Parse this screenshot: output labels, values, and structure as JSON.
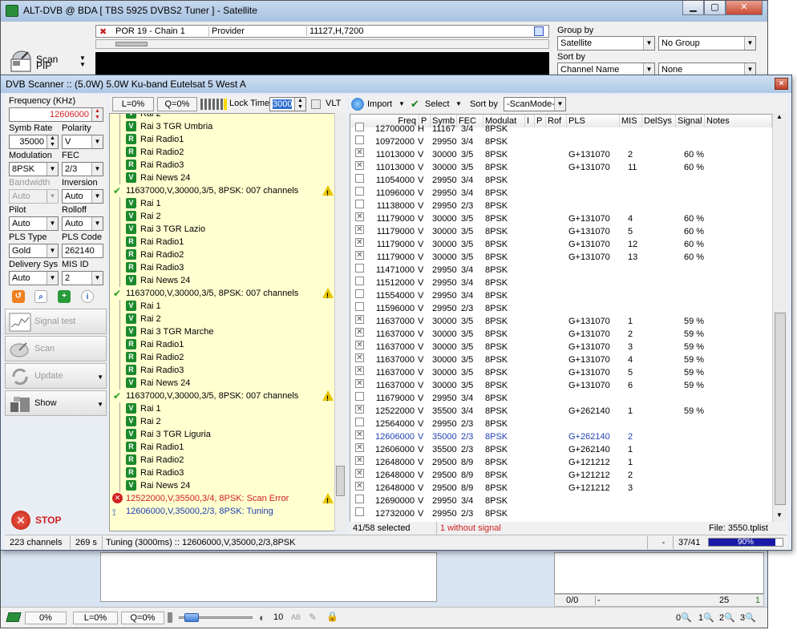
{
  "main_window": {
    "title": "ALT-DVB @ BDA [ TBS 5925 DVBS2 Tuner ] - Satellite",
    "toolbar": {
      "scan_label": "Scan",
      "pip_label": "PIP"
    },
    "status_strip": {
      "channel": "POR 19 - Chain 1",
      "provider": "Provider",
      "tp": "11127,H,7200"
    },
    "group_by": {
      "label": "Group by",
      "value": "Satellite",
      "secondary": "No Group"
    },
    "sort_by": {
      "label": "Sort by",
      "value": "Channel Name",
      "secondary": "None"
    },
    "lower": {
      "count": "0/0",
      "dash": "-",
      "num": "25",
      "num2": "1"
    },
    "bottom_bar": {
      "signal_percent": "0%",
      "level": "L=0%",
      "quality": "Q=0%",
      "volume": "10",
      "ab_label": "AB",
      "q_slots": [
        "0",
        "1",
        "2",
        "3"
      ]
    }
  },
  "scanner": {
    "title": "DVB Scanner :: (5.0W) 5.0W Ku-band Eutelsat 5 West A",
    "close_label": "×",
    "params": {
      "frequency_label": "Frequency (KHz)",
      "frequency_value": "12606000",
      "symb_rate_label": "Symb Rate",
      "symb_rate_value": "35000",
      "polarity_label": "Polarity",
      "polarity_value": "V",
      "modulation_label": "Modulation",
      "modulation_value": "8PSK",
      "fec_label": "FEC",
      "fec_value": "2/3",
      "bandwidth_label": "Bandwidth",
      "bandwidth_value": "Auto",
      "inversion_label": "Inversion",
      "inversion_value": "Auto",
      "pilot_label": "Pilot",
      "pilot_value": "Auto",
      "rolloff_label": "Rolloff",
      "rolloff_value": "Auto",
      "pls_type_label": "PLS Type",
      "pls_type_value": "Gold",
      "pls_code_label": "PLS Code",
      "pls_code_value": "262140",
      "delivery_sys_label": "Delivery Sys",
      "delivery_sys_value": "Auto",
      "mis_id_label": "MIS ID",
      "mis_id_value": "2"
    },
    "buttons": {
      "signal_test": "Signal test",
      "scan": "Scan",
      "update": "Update",
      "show": "Show",
      "stop": "STOP"
    },
    "tree_toolbar": {
      "level": "L=0%",
      "quality": "Q=0%",
      "lock_time_label": "Lock Time",
      "lock_time_value": "3000",
      "vlt_label": "VLT"
    },
    "tree": [
      {
        "type": "ch",
        "icon": "V",
        "text": "Rai 2"
      },
      {
        "type": "ch",
        "icon": "V",
        "text": "Rai 3 TGR Umbria"
      },
      {
        "type": "ch",
        "icon": "R",
        "text": "Rai Radio1"
      },
      {
        "type": "ch",
        "icon": "R",
        "text": "Rai Radio2"
      },
      {
        "type": "ch",
        "icon": "R",
        "text": "Rai Radio3"
      },
      {
        "type": "ch",
        "icon": "V",
        "text": "Rai News 24"
      },
      {
        "type": "tp",
        "text": "11637000,V,30000,3/5, 8PSK: 007 channels",
        "warn": true
      },
      {
        "type": "ch",
        "icon": "V",
        "text": "Rai 1"
      },
      {
        "type": "ch",
        "icon": "V",
        "text": "Rai 2"
      },
      {
        "type": "ch",
        "icon": "V",
        "text": "Rai 3 TGR Lazio"
      },
      {
        "type": "ch",
        "icon": "R",
        "text": "Rai Radio1"
      },
      {
        "type": "ch",
        "icon": "R",
        "text": "Rai Radio2"
      },
      {
        "type": "ch",
        "icon": "R",
        "text": "Rai Radio3"
      },
      {
        "type": "ch",
        "icon": "V",
        "text": "Rai News 24"
      },
      {
        "type": "tp",
        "text": "11637000,V,30000,3/5, 8PSK: 007 channels",
        "warn": true
      },
      {
        "type": "ch",
        "icon": "V",
        "text": "Rai 1"
      },
      {
        "type": "ch",
        "icon": "V",
        "text": "Rai 2"
      },
      {
        "type": "ch",
        "icon": "V",
        "text": "Rai 3 TGR Marche"
      },
      {
        "type": "ch",
        "icon": "R",
        "text": "Rai Radio1"
      },
      {
        "type": "ch",
        "icon": "R",
        "text": "Rai Radio2"
      },
      {
        "type": "ch",
        "icon": "R",
        "text": "Rai Radio3"
      },
      {
        "type": "ch",
        "icon": "V",
        "text": "Rai News 24"
      },
      {
        "type": "tp",
        "text": "11637000,V,30000,3/5, 8PSK: 007 channels",
        "warn": true
      },
      {
        "type": "ch",
        "icon": "V",
        "text": "Rai 1"
      },
      {
        "type": "ch",
        "icon": "V",
        "text": "Rai 2"
      },
      {
        "type": "ch",
        "icon": "V",
        "text": "Rai 3 TGR Liguria"
      },
      {
        "type": "ch",
        "icon": "R",
        "text": "Rai Radio1"
      },
      {
        "type": "ch",
        "icon": "R",
        "text": "Rai Radio2"
      },
      {
        "type": "ch",
        "icon": "R",
        "text": "Rai Radio3"
      },
      {
        "type": "ch",
        "icon": "V",
        "text": "Rai News 24"
      },
      {
        "type": "err",
        "text": "12522000,V,35500,3/4, 8PSK: Scan Error",
        "warn": true
      },
      {
        "type": "tune",
        "text": "12606000,V,35000,2/3, 8PSK: Tuning"
      }
    ],
    "grid_toolbar": {
      "import_label": "Import",
      "select_label": "Select",
      "sort_by_label": "Sort by",
      "sort_by_value": "-ScanMode-"
    },
    "grid_columns": [
      "Freq",
      "P",
      "Symb",
      "FEC",
      "Modulat",
      "I",
      "P",
      "Rof",
      "PLS",
      "MIS",
      "DelSys",
      "Signal",
      "Notes"
    ],
    "grid_rows": [
      {
        "checked": false,
        "freq": "12700000",
        "pol": "H",
        "symb": "11167",
        "fec": "3/4",
        "mod": "8PSK",
        "pls": "",
        "mis": "",
        "signal": ""
      },
      {
        "checked": false,
        "freq": "10972000",
        "pol": "V",
        "symb": "29950",
        "fec": "3/4",
        "mod": "8PSK",
        "pls": "",
        "mis": "",
        "signal": ""
      },
      {
        "checked": true,
        "freq": "11013000",
        "pol": "V",
        "symb": "30000",
        "fec": "3/5",
        "mod": "8PSK",
        "pls": "G+131070",
        "mis": "2",
        "signal": "60 %"
      },
      {
        "checked": true,
        "freq": "11013000",
        "pol": "V",
        "symb": "30000",
        "fec": "3/5",
        "mod": "8PSK",
        "pls": "G+131070",
        "mis": "11",
        "signal": "60 %"
      },
      {
        "checked": false,
        "freq": "11054000",
        "pol": "V",
        "symb": "29950",
        "fec": "3/4",
        "mod": "8PSK",
        "pls": "",
        "mis": "",
        "signal": ""
      },
      {
        "checked": false,
        "freq": "11096000",
        "pol": "V",
        "symb": "29950",
        "fec": "3/4",
        "mod": "8PSK",
        "pls": "",
        "mis": "",
        "signal": ""
      },
      {
        "checked": false,
        "freq": "11138000",
        "pol": "V",
        "symb": "29950",
        "fec": "2/3",
        "mod": "8PSK",
        "pls": "",
        "mis": "",
        "signal": ""
      },
      {
        "checked": true,
        "freq": "11179000",
        "pol": "V",
        "symb": "30000",
        "fec": "3/5",
        "mod": "8PSK",
        "pls": "G+131070",
        "mis": "4",
        "signal": "60 %"
      },
      {
        "checked": true,
        "freq": "11179000",
        "pol": "V",
        "symb": "30000",
        "fec": "3/5",
        "mod": "8PSK",
        "pls": "G+131070",
        "mis": "5",
        "signal": "60 %"
      },
      {
        "checked": true,
        "freq": "11179000",
        "pol": "V",
        "symb": "30000",
        "fec": "3/5",
        "mod": "8PSK",
        "pls": "G+131070",
        "mis": "12",
        "signal": "60 %"
      },
      {
        "checked": true,
        "freq": "11179000",
        "pol": "V",
        "symb": "30000",
        "fec": "3/5",
        "mod": "8PSK",
        "pls": "G+131070",
        "mis": "13",
        "signal": "60 %"
      },
      {
        "checked": false,
        "freq": "11471000",
        "pol": "V",
        "symb": "29950",
        "fec": "3/4",
        "mod": "8PSK",
        "pls": "",
        "mis": "",
        "signal": ""
      },
      {
        "checked": false,
        "freq": "11512000",
        "pol": "V",
        "symb": "29950",
        "fec": "3/4",
        "mod": "8PSK",
        "pls": "",
        "mis": "",
        "signal": ""
      },
      {
        "checked": false,
        "freq": "11554000",
        "pol": "V",
        "symb": "29950",
        "fec": "3/4",
        "mod": "8PSK",
        "pls": "",
        "mis": "",
        "signal": ""
      },
      {
        "checked": false,
        "freq": "11596000",
        "pol": "V",
        "symb": "29950",
        "fec": "2/3",
        "mod": "8PSK",
        "pls": "",
        "mis": "",
        "signal": ""
      },
      {
        "checked": true,
        "freq": "11637000",
        "pol": "V",
        "symb": "30000",
        "fec": "3/5",
        "mod": "8PSK",
        "pls": "G+131070",
        "mis": "1",
        "signal": "59 %"
      },
      {
        "checked": true,
        "freq": "11637000",
        "pol": "V",
        "symb": "30000",
        "fec": "3/5",
        "mod": "8PSK",
        "pls": "G+131070",
        "mis": "2",
        "signal": "59 %"
      },
      {
        "checked": true,
        "freq": "11637000",
        "pol": "V",
        "symb": "30000",
        "fec": "3/5",
        "mod": "8PSK",
        "pls": "G+131070",
        "mis": "3",
        "signal": "59 %"
      },
      {
        "checked": true,
        "freq": "11637000",
        "pol": "V",
        "symb": "30000",
        "fec": "3/5",
        "mod": "8PSK",
        "pls": "G+131070",
        "mis": "4",
        "signal": "59 %"
      },
      {
        "checked": true,
        "freq": "11637000",
        "pol": "V",
        "symb": "30000",
        "fec": "3/5",
        "mod": "8PSK",
        "pls": "G+131070",
        "mis": "5",
        "signal": "59 %"
      },
      {
        "checked": true,
        "freq": "11637000",
        "pol": "V",
        "symb": "30000",
        "fec": "3/5",
        "mod": "8PSK",
        "pls": "G+131070",
        "mis": "6",
        "signal": "59 %"
      },
      {
        "checked": false,
        "freq": "11679000",
        "pol": "V",
        "symb": "29950",
        "fec": "3/4",
        "mod": "8PSK",
        "pls": "",
        "mis": "",
        "signal": ""
      },
      {
        "checked": true,
        "freq": "12522000",
        "pol": "V",
        "symb": "35500",
        "fec": "3/4",
        "mod": "8PSK",
        "pls": "G+262140",
        "mis": "1",
        "signal": "59 %"
      },
      {
        "checked": false,
        "freq": "12564000",
        "pol": "V",
        "symb": "29950",
        "fec": "2/3",
        "mod": "8PSK",
        "pls": "",
        "mis": "",
        "signal": ""
      },
      {
        "checked": true,
        "freq": "12606000",
        "pol": "V",
        "symb": "35000",
        "fec": "2/3",
        "mod": "8PSK",
        "pls": "G+262140",
        "mis": "2",
        "signal": "",
        "current": true
      },
      {
        "checked": true,
        "freq": "12606000",
        "pol": "V",
        "symb": "35500",
        "fec": "2/3",
        "mod": "8PSK",
        "pls": "G+262140",
        "mis": "1",
        "signal": ""
      },
      {
        "checked": true,
        "freq": "12648000",
        "pol": "V",
        "symb": "29500",
        "fec": "8/9",
        "mod": "8PSK",
        "pls": "G+121212",
        "mis": "1",
        "signal": ""
      },
      {
        "checked": true,
        "freq": "12648000",
        "pol": "V",
        "symb": "29500",
        "fec": "8/9",
        "mod": "8PSK",
        "pls": "G+121212",
        "mis": "2",
        "signal": ""
      },
      {
        "checked": true,
        "freq": "12648000",
        "pol": "V",
        "symb": "29500",
        "fec": "8/9",
        "mod": "8PSK",
        "pls": "G+121212",
        "mis": "3",
        "signal": ""
      },
      {
        "checked": false,
        "freq": "12690000",
        "pol": "V",
        "symb": "29950",
        "fec": "3/4",
        "mod": "8PSK",
        "pls": "",
        "mis": "",
        "signal": ""
      },
      {
        "checked": false,
        "freq": "12732000",
        "pol": "V",
        "symb": "29950",
        "fec": "2/3",
        "mod": "8PSK",
        "pls": "",
        "mis": "",
        "signal": ""
      }
    ],
    "grid_status": {
      "selected": "41/58 selected",
      "without_signal": "1 without signal",
      "file": "File: 3550.tplist"
    },
    "status_bar": {
      "channels": "223 channels",
      "seconds": "269 s",
      "tuning": "Tuning (3000ms) :: 12606000,V,35000,2/3,8PSK",
      "dash": "-",
      "progress_count": "37/41",
      "progress_percent": "90%",
      "progress_fraction": 0.9
    },
    "colors": {
      "error": "#d02020",
      "tuning": "#2040b0",
      "frequency": "#d02020"
    }
  }
}
